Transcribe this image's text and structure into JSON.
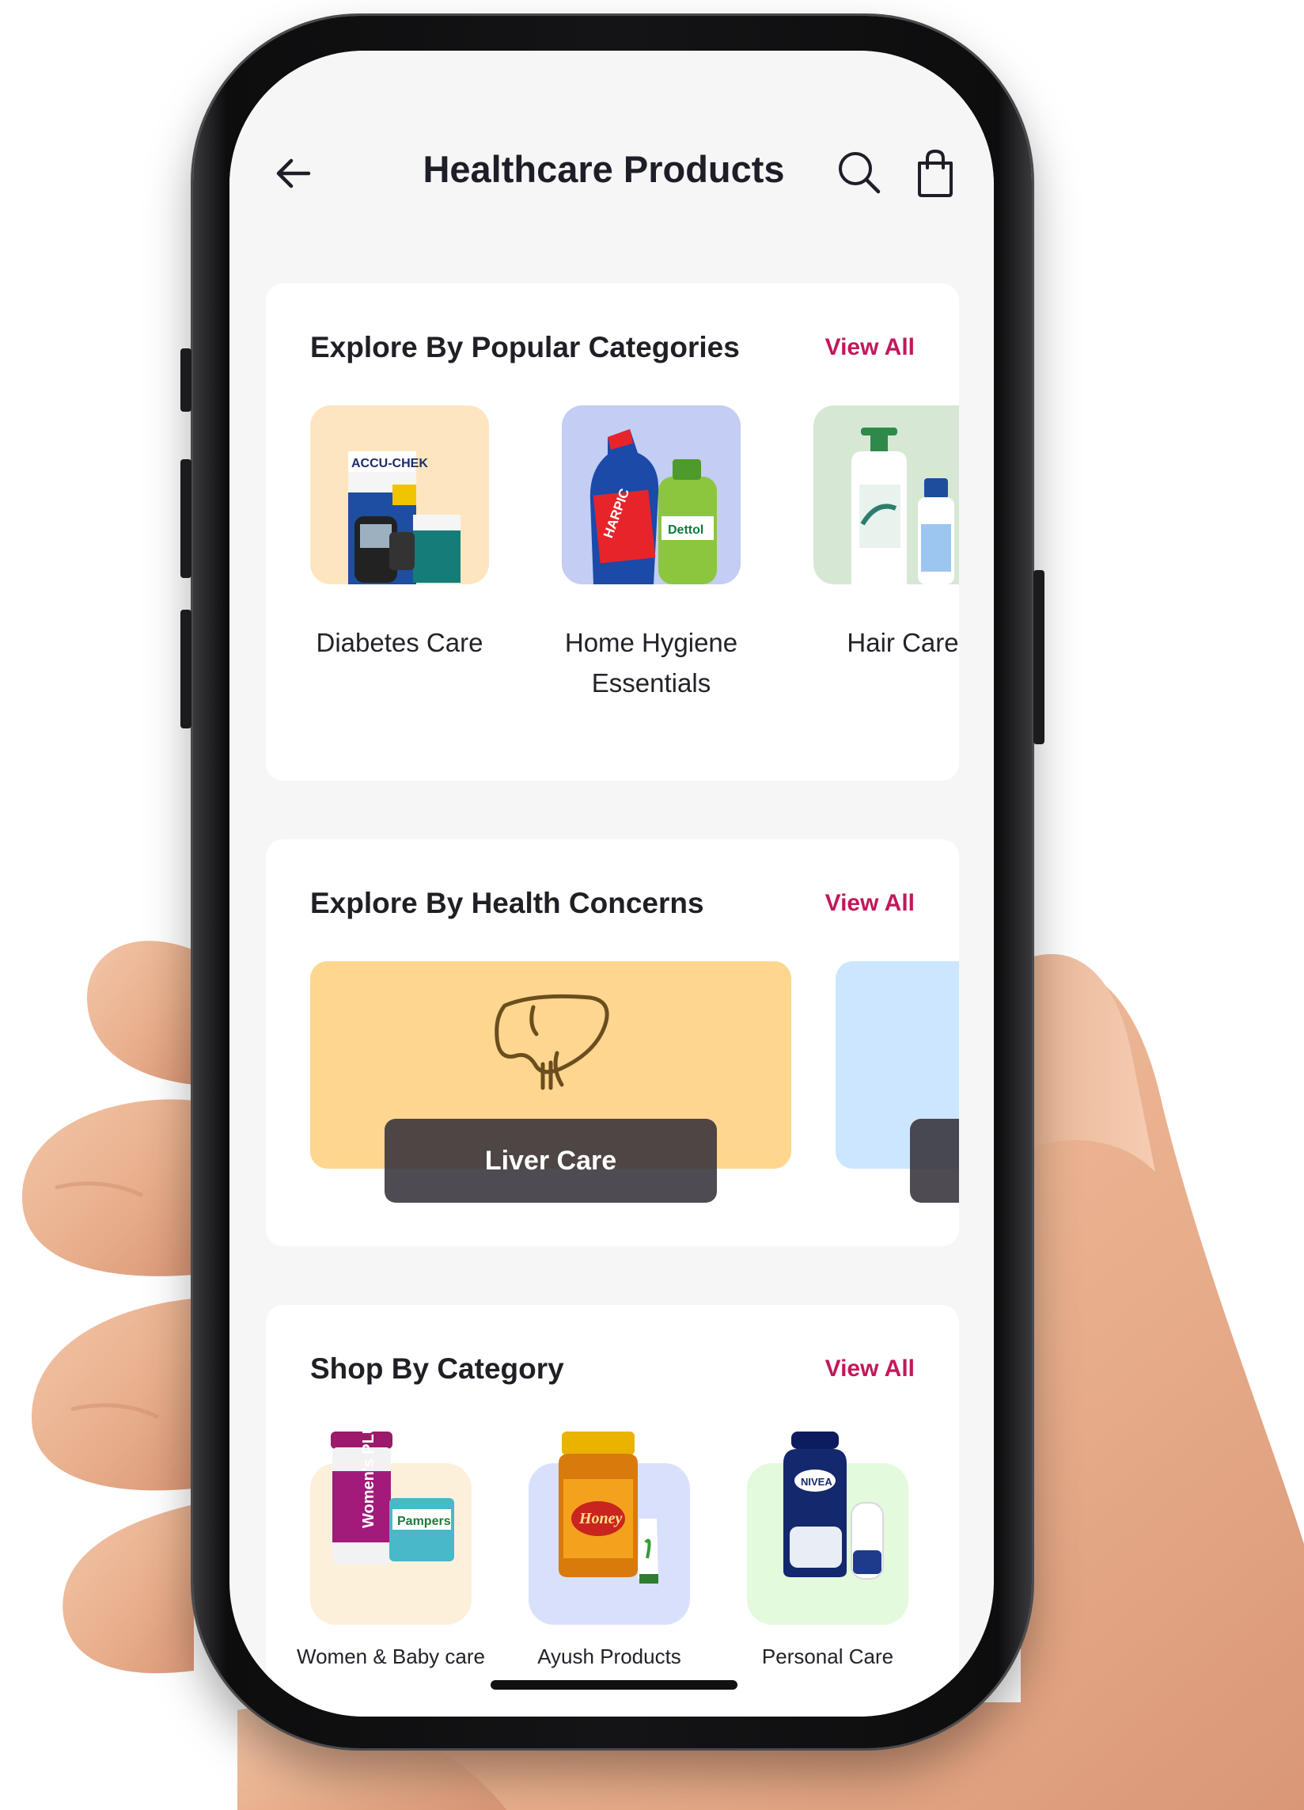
{
  "header": {
    "title": "Healthcare Products",
    "back_icon": "arrow-left-icon",
    "search_icon": "search-icon",
    "cart_icon": "shopping-bag-icon"
  },
  "popular_categories": {
    "title": "Explore By Popular Categories",
    "view_all": "View All",
    "items": [
      {
        "label": "Diabetes Care",
        "tile_color": "#fde6bf"
      },
      {
        "label": "Home Hygiene Essentials",
        "tile_color": "#c4cdf3"
      },
      {
        "label": "Hair Care",
        "tile_color": "#d6e8d4"
      }
    ]
  },
  "health_concerns": {
    "title": "Explore By Health Concerns",
    "view_all": "View All",
    "items": [
      {
        "label": "Liver Care",
        "icon": "liver-icon",
        "tile_color": "#fed68f"
      },
      {
        "label": "",
        "tile_color": "#cbe6fe"
      }
    ]
  },
  "shop_by_category": {
    "title": "Shop By Category",
    "view_all": "View All",
    "items": [
      {
        "label": "Women & Baby care",
        "tile_color": "#fdf0db"
      },
      {
        "label": "Ayush Products",
        "tile_color": "#d9e0fb"
      },
      {
        "label": "Personal Care",
        "tile_color": "#e3fadc"
      }
    ]
  },
  "colors": {
    "accent": "#c2185b",
    "screen_bg": "#f6f6f7",
    "card_bg": "#ffffff",
    "text": "#1e1e28"
  }
}
